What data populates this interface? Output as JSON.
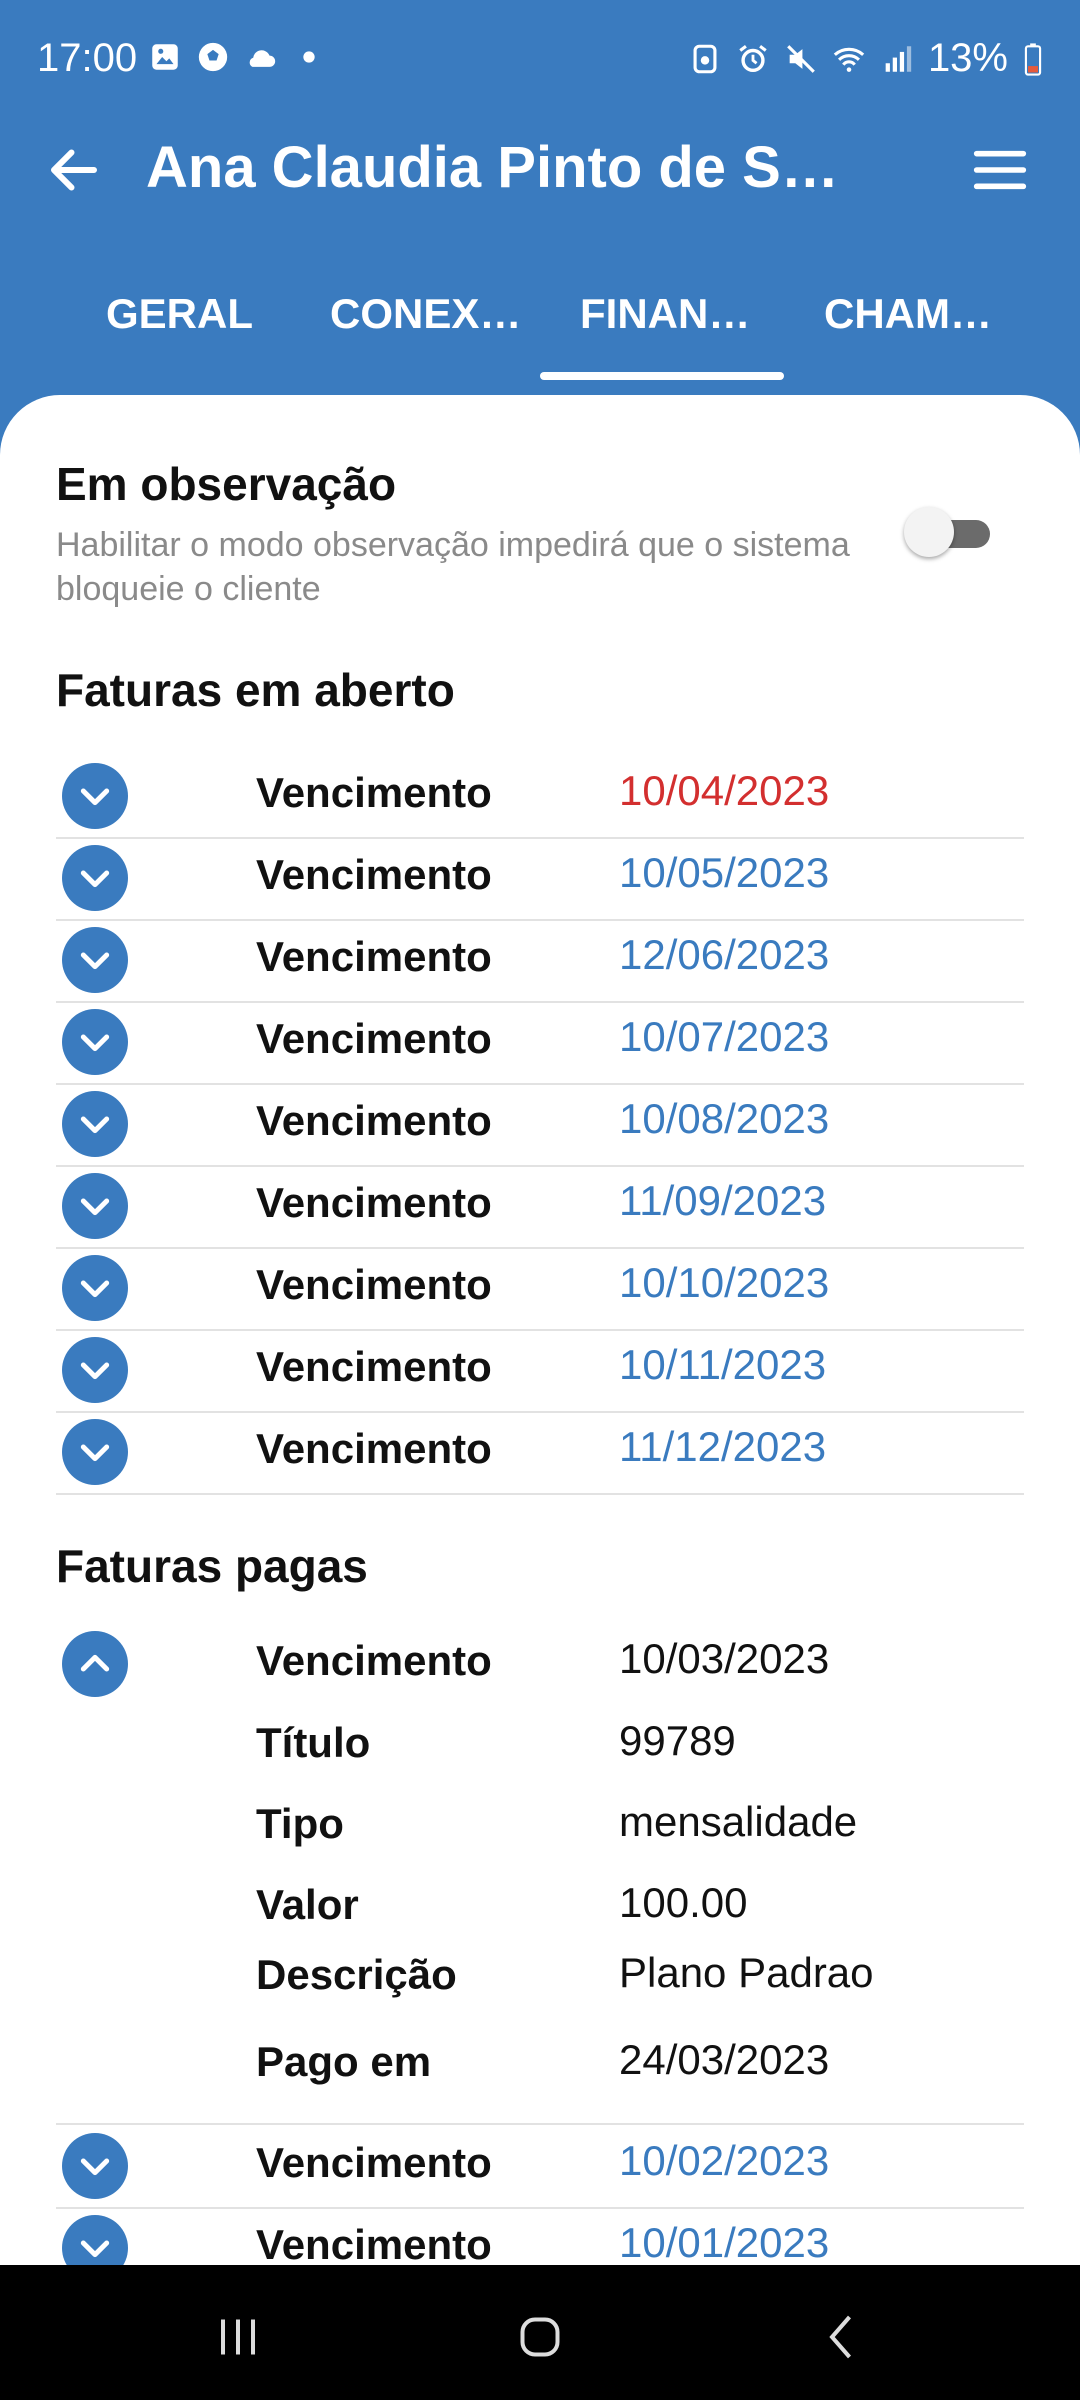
{
  "status_bar": {
    "time": "17:00",
    "icons": [
      "image-icon",
      "soccer-ball-icon",
      "cloud-icon",
      "dot-icon"
    ],
    "right_icons": [
      "nfc-icon",
      "alarm-icon",
      "mute-icon",
      "wifi-icon",
      "signal-icon"
    ],
    "battery": "13%"
  },
  "header": {
    "title": "Ana Claudia Pinto de So…"
  },
  "tabs": [
    {
      "label": "GERAL",
      "active": false
    },
    {
      "label": "CONEX…",
      "active": false
    },
    {
      "label": "FINAN…",
      "active": true
    },
    {
      "label": "CHAM…",
      "active": false
    }
  ],
  "observation": {
    "title": "Em observação",
    "description": "Habilitar o modo observação impedirá que o sistema bloqueie o cliente",
    "enabled": false
  },
  "open_invoices": {
    "title": "Faturas em aberto",
    "rows": [
      {
        "label": "Vencimento",
        "date": "10/04/2023",
        "overdue": true
      },
      {
        "label": "Vencimento",
        "date": "10/05/2023",
        "overdue": false
      },
      {
        "label": "Vencimento",
        "date": "12/06/2023",
        "overdue": false
      },
      {
        "label": "Vencimento",
        "date": "10/07/2023",
        "overdue": false
      },
      {
        "label": "Vencimento",
        "date": "10/08/2023",
        "overdue": false
      },
      {
        "label": "Vencimento",
        "date": "11/09/2023",
        "overdue": false
      },
      {
        "label": "Vencimento",
        "date": "10/10/2023",
        "overdue": false
      },
      {
        "label": "Vencimento",
        "date": "10/11/2023",
        "overdue": false
      },
      {
        "label": "Vencimento",
        "date": "11/12/2023",
        "overdue": false
      }
    ]
  },
  "paid_invoices": {
    "title": "Faturas pagas",
    "expanded": {
      "fields": [
        {
          "label": "Vencimento",
          "value": "10/03/2023"
        },
        {
          "label": "Título",
          "value": "99789"
        },
        {
          "label": "Tipo",
          "value": "mensalidade"
        },
        {
          "label": "Valor",
          "value": "100.00"
        },
        {
          "label": "Descrição",
          "value": "Plano Padrao"
        },
        {
          "label": "Pago em",
          "value": "24/03/2023"
        }
      ]
    },
    "rows": [
      {
        "label": "Vencimento",
        "date": "10/02/2023"
      },
      {
        "label": "Vencimento",
        "date": "10/01/2023"
      }
    ]
  },
  "colors": {
    "primary": "#3a7bbf",
    "overdue": "#d32f2f",
    "muted": "#8a8a8a"
  }
}
